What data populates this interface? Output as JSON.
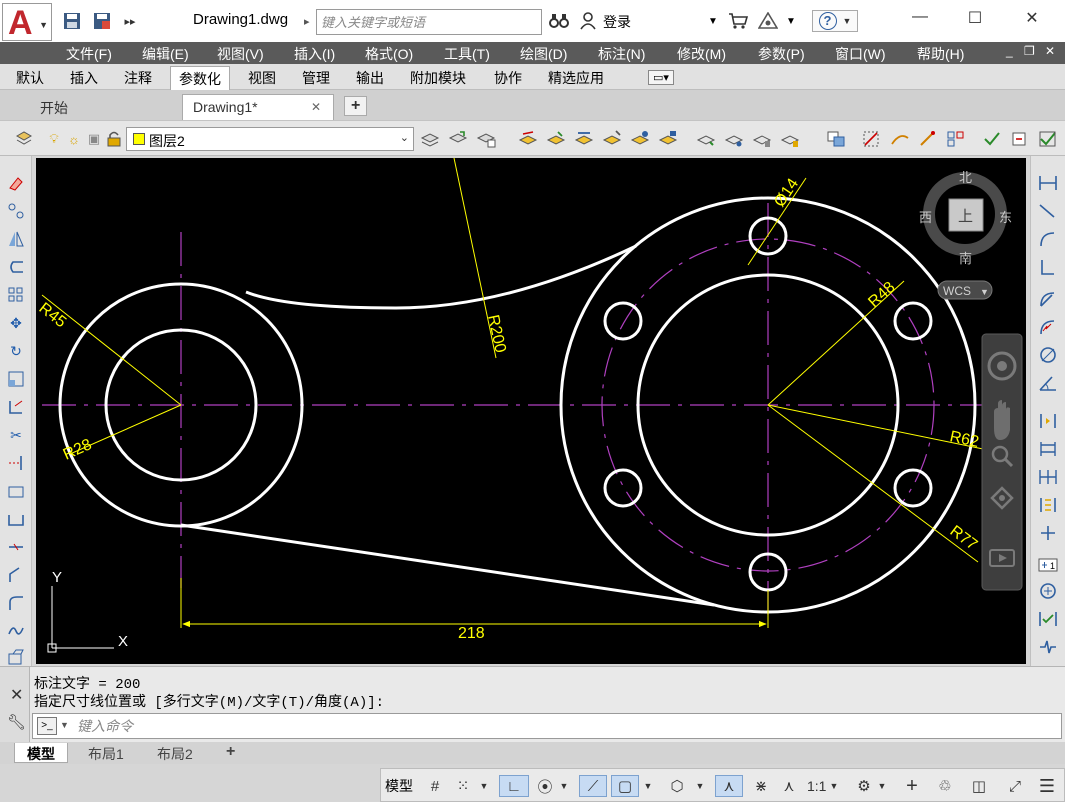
{
  "app": {
    "logo_letter": "A",
    "doc_title": "Drawing1.dwg",
    "search_placeholder": "键入关键字或短语",
    "login_label": "登录",
    "help_label": "?"
  },
  "menu": [
    "文件(F)",
    "编辑(E)",
    "视图(V)",
    "插入(I)",
    "格式(O)",
    "工具(T)",
    "绘图(D)",
    "标注(N)",
    "修改(M)",
    "参数(P)",
    "窗口(W)",
    "帮助(H)"
  ],
  "ribbon_tabs": [
    "默认",
    "插入",
    "注释",
    "参数化",
    "视图",
    "管理",
    "输出",
    "附加模块",
    "协作",
    "精选应用"
  ],
  "ribbon_active": "参数化",
  "doc_tabs": {
    "start": "开始",
    "drawing": "Drawing1*",
    "close": "✕",
    "add": "+"
  },
  "layer": {
    "name": "图层2",
    "color": "#ffff00"
  },
  "viewcube": {
    "north": "北",
    "south": "南",
    "east": "东",
    "west": "西",
    "face": "上",
    "wcs": "WCS"
  },
  "drawing": {
    "dimensions": {
      "r45": "R45",
      "r28": "R28",
      "r200": "R200",
      "d14": "Ø14",
      "r48": "R48",
      "r62": "R62",
      "r77": "R77",
      "len218": "218"
    },
    "ucs": {
      "x": "X",
      "y": "Y"
    },
    "colors": {
      "geometry": "#ffffff",
      "dimension": "#ffff00",
      "center_line": "#b040c0"
    }
  },
  "command": {
    "history": [
      "标注文字 = 200",
      "指定尺寸线位置或 [多行文字(M)/文字(T)/角度(A)]:"
    ],
    "placeholder": "键入命令"
  },
  "layout_tabs": [
    "模型",
    "布局1",
    "布局2"
  ],
  "status": {
    "model": "模型",
    "scale": "1:1"
  }
}
